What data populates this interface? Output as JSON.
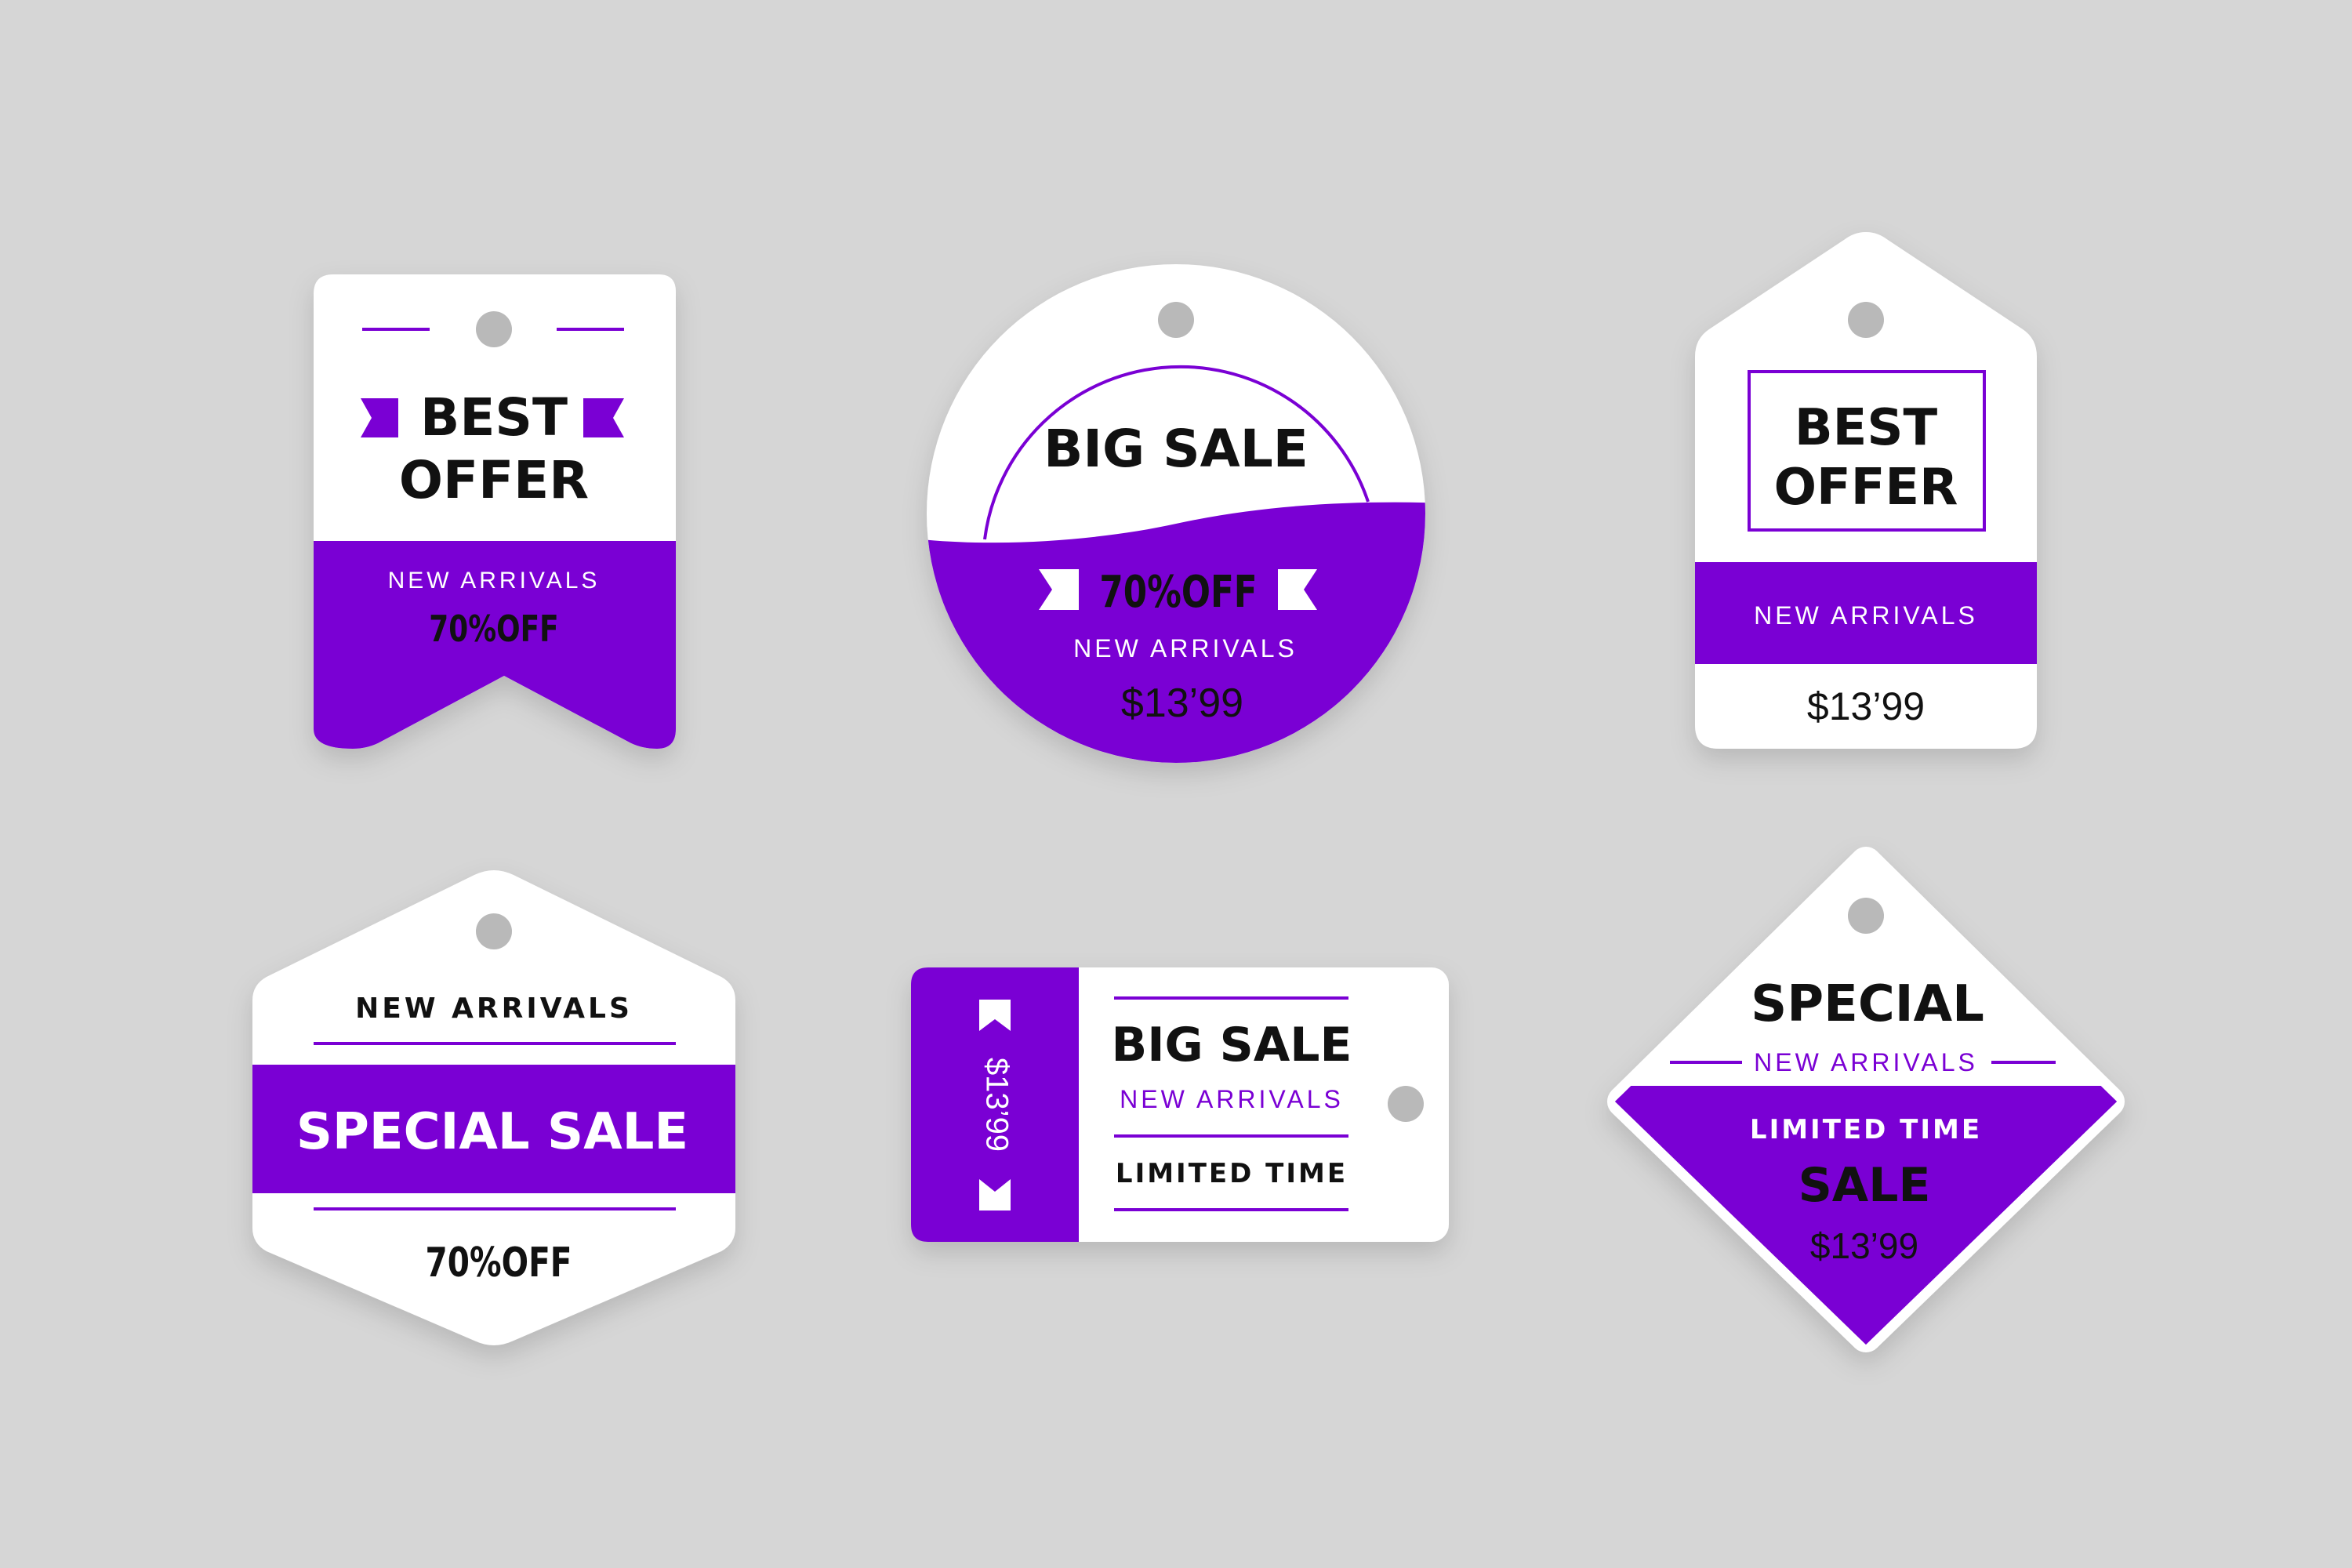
{
  "colors": {
    "background": "#d6d6d6",
    "purple": "#7a00d4",
    "white": "#ffffff",
    "hole": "#b9b9b9",
    "black": "#111111"
  },
  "tags": {
    "tag1": {
      "title_line1": "BEST",
      "title_line2": "OFFER",
      "subtitle": "NEW ARRIVALS",
      "discount": "70%OFF"
    },
    "tag2": {
      "title": "BIG SALE",
      "discount": "70%OFF",
      "subtitle": "NEW ARRIVALS",
      "price": "$13’99"
    },
    "tag3": {
      "title_line1": "BEST",
      "title_line2": "OFFER",
      "subtitle": "NEW ARRIVALS",
      "price": "$13’99"
    },
    "tag4": {
      "subtitle": "NEW ARRIVALS",
      "title": "SPECIAL SALE",
      "discount": "70%OFF"
    },
    "tag5": {
      "price": "$13’99",
      "title": "BIG SALE",
      "subtitle": "NEW ARRIVALS",
      "note": "LIMITED TIME"
    },
    "tag6": {
      "title": "SPECIAL",
      "subtitle": "NEW ARRIVALS",
      "note": "LIMITED TIME",
      "sale": "SALE",
      "price": "$13’99"
    }
  }
}
